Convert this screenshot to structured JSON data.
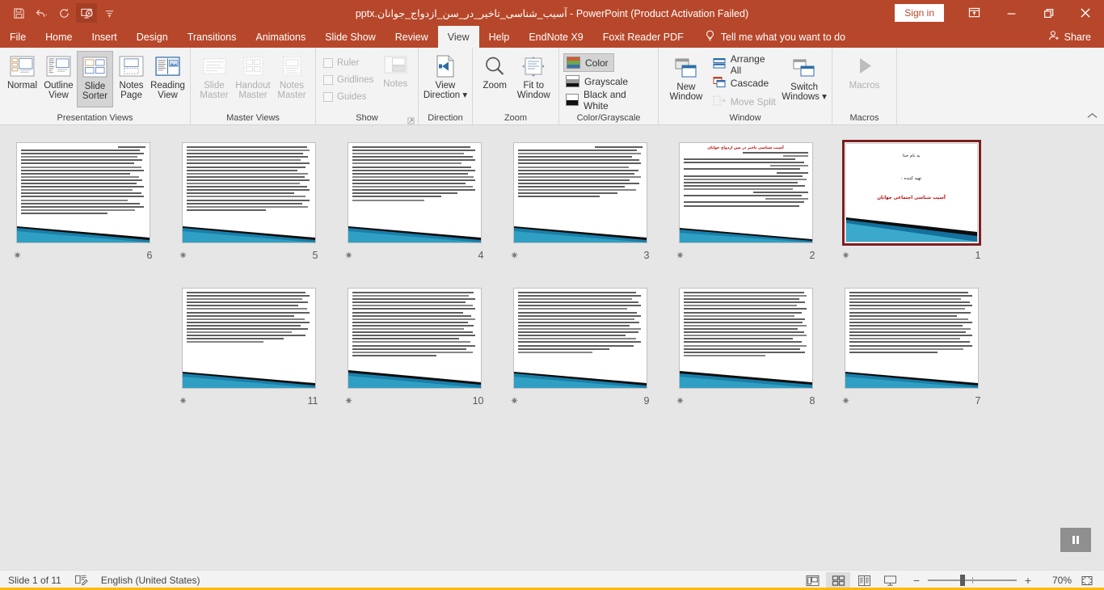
{
  "titlebar": {
    "document_name": "آسیب_شناسی_تاخیر_در_سن_ازدواج_جوانان.pptx",
    "separator": "-",
    "app_title": "PowerPoint (Product Activation Failed)",
    "signin_label": "Sign in",
    "quick_access": [
      {
        "name": "save-icon",
        "label": "Save"
      },
      {
        "name": "undo-icon",
        "label": "Undo"
      },
      {
        "name": "redo-icon",
        "label": "Redo"
      },
      {
        "name": "start-presentation-icon",
        "label": "Start From Beginning"
      },
      {
        "name": "customize-qat-icon",
        "label": "Customize Quick Access Toolbar"
      }
    ],
    "window_controls": {
      "ribbon_display": "Ribbon Display Options",
      "minimize": "Minimize",
      "restore": "Restore Down",
      "close": "Close"
    }
  },
  "tabs": [
    {
      "label": "File",
      "active": false
    },
    {
      "label": "Home",
      "active": false
    },
    {
      "label": "Insert",
      "active": false
    },
    {
      "label": "Design",
      "active": false
    },
    {
      "label": "Transitions",
      "active": false
    },
    {
      "label": "Animations",
      "active": false
    },
    {
      "label": "Slide Show",
      "active": false
    },
    {
      "label": "Review",
      "active": false
    },
    {
      "label": "View",
      "active": true
    },
    {
      "label": "Help",
      "active": false
    },
    {
      "label": "EndNote X9",
      "active": false
    },
    {
      "label": "Foxit Reader PDF",
      "active": false
    }
  ],
  "tellme": {
    "label": "Tell me what you want to do"
  },
  "share": {
    "label": "Share"
  },
  "ribbon": {
    "groups": {
      "presentation_views": {
        "label": "Presentation Views",
        "buttons": [
          {
            "line1": "Normal",
            "line2": "",
            "icon": "normal-view-icon",
            "selected": false,
            "disabled": false
          },
          {
            "line1": "Outline",
            "line2": "View",
            "icon": "outline-view-icon",
            "selected": false,
            "disabled": false
          },
          {
            "line1": "Slide",
            "line2": "Sorter",
            "icon": "slide-sorter-icon",
            "selected": true,
            "disabled": false
          },
          {
            "line1": "Notes",
            "line2": "Page",
            "icon": "notes-page-icon",
            "selected": false,
            "disabled": false
          },
          {
            "line1": "Reading",
            "line2": "View",
            "icon": "reading-view-icon",
            "selected": false,
            "disabled": false
          }
        ]
      },
      "master_views": {
        "label": "Master Views",
        "buttons": [
          {
            "line1": "Slide",
            "line2": "Master",
            "icon": "slide-master-icon",
            "selected": false,
            "disabled": true
          },
          {
            "line1": "Handout",
            "line2": "Master",
            "icon": "handout-master-icon",
            "selected": false,
            "disabled": true
          },
          {
            "line1": "Notes",
            "line2": "Master",
            "icon": "notes-master-icon",
            "selected": false,
            "disabled": true
          }
        ]
      },
      "show": {
        "label": "Show",
        "checkboxes": [
          {
            "label": "Ruler",
            "checked": false,
            "disabled": true
          },
          {
            "label": "Gridlines",
            "checked": false,
            "disabled": true
          },
          {
            "label": "Guides",
            "checked": false,
            "disabled": true
          }
        ],
        "notes_button": {
          "line1": "Notes",
          "icon": "notes-icon",
          "disabled": true
        }
      },
      "direction": {
        "label": "Direction",
        "button": {
          "line1": "View",
          "line2": "Direction",
          "icon": "view-direction-icon",
          "has_dropdown": true
        }
      },
      "zoom": {
        "label": "Zoom",
        "buttons": [
          {
            "line1": "Zoom",
            "line2": "",
            "icon": "zoom-icon"
          },
          {
            "line1": "Fit to",
            "line2": "Window",
            "icon": "fit-to-window-icon"
          }
        ]
      },
      "color_grayscale": {
        "label": "Color/Grayscale",
        "options": [
          {
            "label": "Color",
            "selected": true
          },
          {
            "label": "Grayscale",
            "selected": false
          },
          {
            "label": "Black and White",
            "selected": false
          }
        ]
      },
      "window": {
        "label": "Window",
        "new_window": {
          "line1": "New",
          "line2": "Window",
          "icon": "new-window-icon"
        },
        "items": [
          {
            "label": "Arrange All",
            "icon": "arrange-all-icon",
            "disabled": false
          },
          {
            "label": "Cascade",
            "icon": "cascade-icon",
            "disabled": false
          },
          {
            "label": "Move Split",
            "icon": "move-split-icon",
            "disabled": true
          }
        ],
        "switch_windows": {
          "line1": "Switch",
          "line2": "Windows",
          "icon": "switch-windows-icon",
          "has_dropdown": true
        }
      },
      "macros": {
        "label": "Macros",
        "button": {
          "line1": "Macros",
          "line2": "",
          "icon": "macros-icon",
          "disabled": true
        }
      }
    },
    "collapse_label": "Collapse the Ribbon"
  },
  "sorter": {
    "selected_slide": 1,
    "star_glyph": "✷",
    "slides": [
      {
        "number": "6",
        "type": "text",
        "selected": false,
        "title": "",
        "lines": 22
      },
      {
        "number": "5",
        "type": "text",
        "selected": false,
        "title": "",
        "lines": 21
      },
      {
        "number": "4",
        "type": "text",
        "selected": false,
        "title": "",
        "lines": 19
      },
      {
        "number": "3",
        "type": "text",
        "selected": false,
        "title": "",
        "lines": 18
      },
      {
        "number": "2",
        "type": "text",
        "selected": false,
        "title": "آسیب شناسی تاخیر در سن ازدواج جوانان",
        "lines": 20
      },
      {
        "number": "1",
        "type": "title",
        "selected": true,
        "line1": "به نام خدا",
        "line2": "تهیه کننده :",
        "line3": "آسیب شناسی اجتماعی جوانان"
      },
      {
        "number": "11",
        "type": "text",
        "selected": false,
        "title": "",
        "lines": 18
      },
      {
        "number": "10",
        "type": "text",
        "selected": false,
        "title": "",
        "lines": 22
      },
      {
        "number": "9",
        "type": "text",
        "selected": false,
        "title": "",
        "lines": 21
      },
      {
        "number": "8",
        "type": "text",
        "selected": false,
        "title": "",
        "lines": 22
      },
      {
        "number": "7",
        "type": "text",
        "selected": false,
        "title": "",
        "lines": 21
      }
    ]
  },
  "statusbar": {
    "slide_indicator": "Slide 1 of 11",
    "language": "English (United States)",
    "notes_icon": "notes-spellcheck-icon",
    "views": [
      {
        "name": "normal-view",
        "active": false
      },
      {
        "name": "slide-sorter-view",
        "active": true
      },
      {
        "name": "reading-view",
        "active": false
      },
      {
        "name": "slide-show-view",
        "active": false
      }
    ],
    "zoom_out": "−",
    "zoom_in": "+",
    "zoom_level": "70%",
    "fit_slide": "Fit slide to current window"
  },
  "colors": {
    "accent": "#b7472a",
    "ribbon_bg": "#f3f3f3",
    "workspace_bg": "#e6e6e6",
    "selection_border": "#7b1f1f",
    "status_accent": "#ffb900",
    "slide_title_red": "#c00000",
    "slide_deco_blue": "#1f7fa8"
  }
}
